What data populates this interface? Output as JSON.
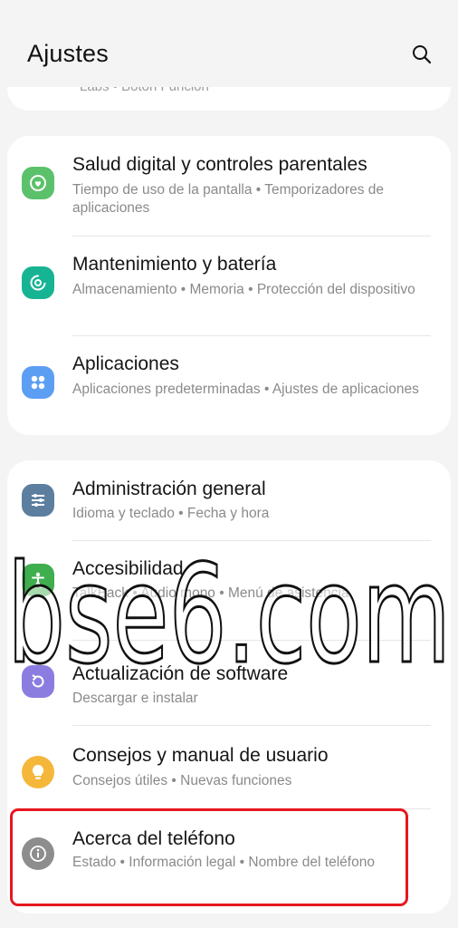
{
  "header": {
    "title": "Ajustes"
  },
  "top_card": {
    "partial_text": "Labs  •  Botón Función"
  },
  "group_a": [
    {
      "title": "Salud digital y controles parentales",
      "subtitle": "Tiempo de uso de la pantalla  •  Temporizadores de aplicaciones",
      "icon": "digital-wellbeing-icon",
      "color": "#5cc16b"
    },
    {
      "title": "Mantenimiento y batería",
      "subtitle": "Almacenamiento  •  Memoria  •  Protección del dispositivo",
      "icon": "device-care-icon",
      "color": "#17b494"
    },
    {
      "title": "Aplicaciones",
      "subtitle": "Aplicaciones predeterminadas  •  Ajustes de aplicaciones",
      "icon": "apps-icon",
      "color": "#5c9ef2"
    }
  ],
  "group_b": [
    {
      "title": "Administración general",
      "subtitle": "Idioma y teclado  •  Fecha y hora",
      "icon": "general-management-icon",
      "color": "#5d7f9f"
    },
    {
      "title": "Accesibilidad",
      "subtitle": "TalkBack  •  Audio mono  •  Menú de asistencia",
      "icon": "accessibility-icon",
      "color": "#3fae4e"
    },
    {
      "title": "Actualización de software",
      "subtitle": "Descargar e instalar",
      "icon": "software-update-icon",
      "color": "#8b7de0"
    },
    {
      "title": "Consejos y manual de usuario",
      "subtitle": "Consejos útiles  •  Nuevas funciones",
      "icon": "tips-icon",
      "color": "#f4b73a"
    },
    {
      "title": "Acerca del teléfono",
      "subtitle": "Estado  •  Información legal  •  Nombre del teléfono",
      "icon": "about-phone-icon",
      "color": "#8d8d8d"
    }
  ],
  "watermark": {
    "text": "bse6.com"
  },
  "colors": {
    "highlight": "#e6171f",
    "background": "#f4f4f4",
    "card": "#ffffff"
  }
}
